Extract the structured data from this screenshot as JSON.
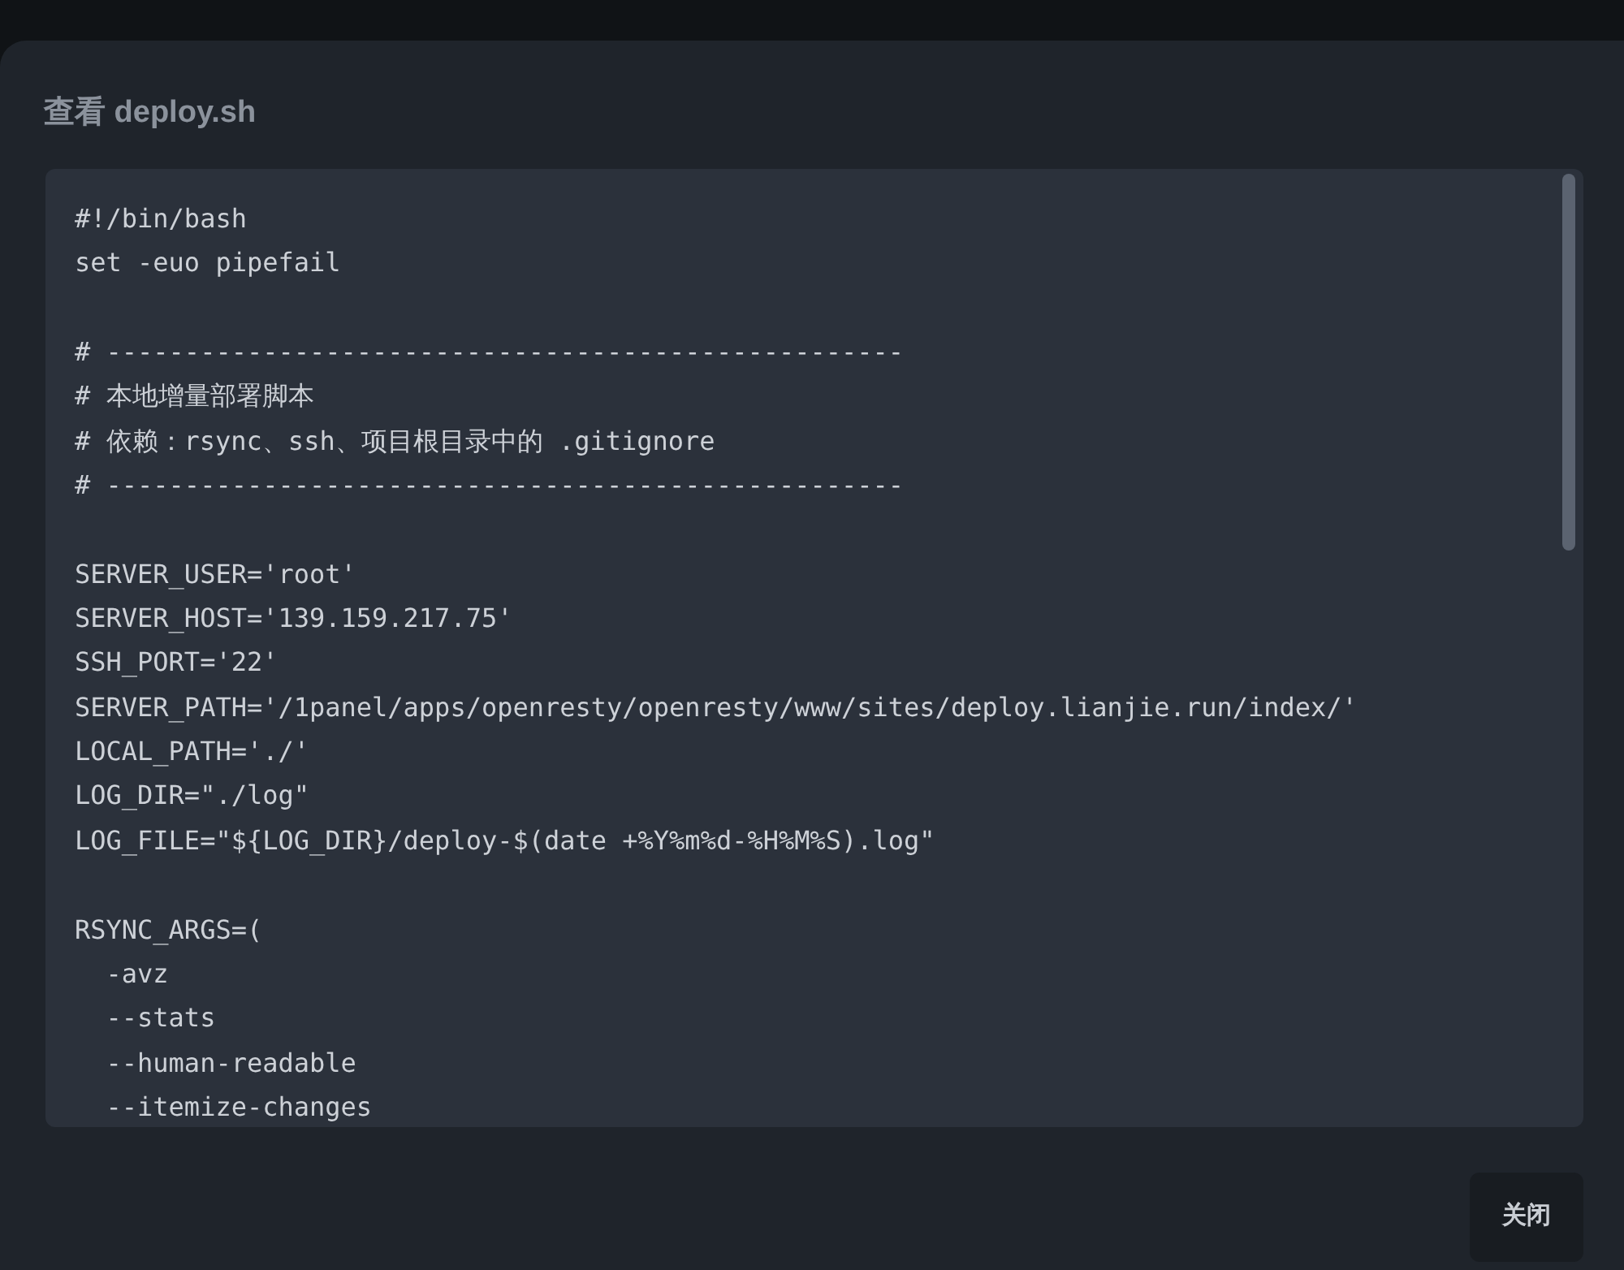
{
  "dialog": {
    "title": "查看 deploy.sh",
    "code_blocks": [
      [
        "#!/bin/bash",
        "set -euo pipefail"
      ],
      [
        "# ---------------------------------------------------",
        "# 本地增量部署脚本",
        "# 依赖：rsync、ssh、项目根目录中的 .gitignore",
        "# ---------------------------------------------------"
      ],
      [
        "SERVER_USER='root'",
        "SERVER_HOST='139.159.217.75'",
        "SSH_PORT='22'",
        "SERVER_PATH='/1panel/apps/openresty/openresty/www/sites/deploy.lianjie.run/index/'",
        "LOCAL_PATH='./'",
        "LOG_DIR=\"./log\"",
        "LOG_FILE=\"${LOG_DIR}/deploy-$(date +%Y%m%d-%H%M%S).log\""
      ],
      [
        "RSYNC_ARGS=(",
        "  -avz",
        "  --stats",
        "  --human-readable",
        "  --itemize-changes"
      ]
    ],
    "close_button": "关闭"
  }
}
